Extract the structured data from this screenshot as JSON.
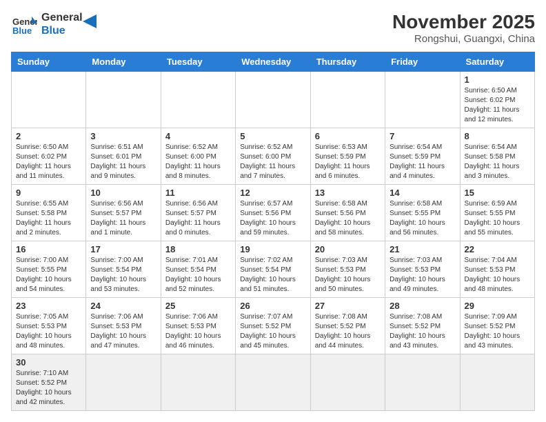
{
  "header": {
    "logo_general": "General",
    "logo_blue": "Blue",
    "month_title": "November 2025",
    "location": "Rongshui, Guangxi, China"
  },
  "weekdays": [
    "Sunday",
    "Monday",
    "Tuesday",
    "Wednesday",
    "Thursday",
    "Friday",
    "Saturday"
  ],
  "weeks": [
    [
      {
        "day": "",
        "info": ""
      },
      {
        "day": "",
        "info": ""
      },
      {
        "day": "",
        "info": ""
      },
      {
        "day": "",
        "info": ""
      },
      {
        "day": "",
        "info": ""
      },
      {
        "day": "",
        "info": ""
      },
      {
        "day": "1",
        "info": "Sunrise: 6:50 AM\nSunset: 6:02 PM\nDaylight: 11 hours and 12 minutes."
      }
    ],
    [
      {
        "day": "2",
        "info": "Sunrise: 6:50 AM\nSunset: 6:02 PM\nDaylight: 11 hours and 11 minutes."
      },
      {
        "day": "3",
        "info": "Sunrise: 6:51 AM\nSunset: 6:01 PM\nDaylight: 11 hours and 9 minutes."
      },
      {
        "day": "4",
        "info": "Sunrise: 6:52 AM\nSunset: 6:00 PM\nDaylight: 11 hours and 8 minutes."
      },
      {
        "day": "5",
        "info": "Sunrise: 6:52 AM\nSunset: 6:00 PM\nDaylight: 11 hours and 7 minutes."
      },
      {
        "day": "6",
        "info": "Sunrise: 6:53 AM\nSunset: 5:59 PM\nDaylight: 11 hours and 6 minutes."
      },
      {
        "day": "7",
        "info": "Sunrise: 6:54 AM\nSunset: 5:59 PM\nDaylight: 11 hours and 4 minutes."
      },
      {
        "day": "8",
        "info": "Sunrise: 6:54 AM\nSunset: 5:58 PM\nDaylight: 11 hours and 3 minutes."
      }
    ],
    [
      {
        "day": "9",
        "info": "Sunrise: 6:55 AM\nSunset: 5:58 PM\nDaylight: 11 hours and 2 minutes."
      },
      {
        "day": "10",
        "info": "Sunrise: 6:56 AM\nSunset: 5:57 PM\nDaylight: 11 hours and 1 minute."
      },
      {
        "day": "11",
        "info": "Sunrise: 6:56 AM\nSunset: 5:57 PM\nDaylight: 11 hours and 0 minutes."
      },
      {
        "day": "12",
        "info": "Sunrise: 6:57 AM\nSunset: 5:56 PM\nDaylight: 10 hours and 59 minutes."
      },
      {
        "day": "13",
        "info": "Sunrise: 6:58 AM\nSunset: 5:56 PM\nDaylight: 10 hours and 58 minutes."
      },
      {
        "day": "14",
        "info": "Sunrise: 6:58 AM\nSunset: 5:55 PM\nDaylight: 10 hours and 56 minutes."
      },
      {
        "day": "15",
        "info": "Sunrise: 6:59 AM\nSunset: 5:55 PM\nDaylight: 10 hours and 55 minutes."
      }
    ],
    [
      {
        "day": "16",
        "info": "Sunrise: 7:00 AM\nSunset: 5:55 PM\nDaylight: 10 hours and 54 minutes."
      },
      {
        "day": "17",
        "info": "Sunrise: 7:00 AM\nSunset: 5:54 PM\nDaylight: 10 hours and 53 minutes."
      },
      {
        "day": "18",
        "info": "Sunrise: 7:01 AM\nSunset: 5:54 PM\nDaylight: 10 hours and 52 minutes."
      },
      {
        "day": "19",
        "info": "Sunrise: 7:02 AM\nSunset: 5:54 PM\nDaylight: 10 hours and 51 minutes."
      },
      {
        "day": "20",
        "info": "Sunrise: 7:03 AM\nSunset: 5:53 PM\nDaylight: 10 hours and 50 minutes."
      },
      {
        "day": "21",
        "info": "Sunrise: 7:03 AM\nSunset: 5:53 PM\nDaylight: 10 hours and 49 minutes."
      },
      {
        "day": "22",
        "info": "Sunrise: 7:04 AM\nSunset: 5:53 PM\nDaylight: 10 hours and 48 minutes."
      }
    ],
    [
      {
        "day": "23",
        "info": "Sunrise: 7:05 AM\nSunset: 5:53 PM\nDaylight: 10 hours and 48 minutes."
      },
      {
        "day": "24",
        "info": "Sunrise: 7:06 AM\nSunset: 5:53 PM\nDaylight: 10 hours and 47 minutes."
      },
      {
        "day": "25",
        "info": "Sunrise: 7:06 AM\nSunset: 5:53 PM\nDaylight: 10 hours and 46 minutes."
      },
      {
        "day": "26",
        "info": "Sunrise: 7:07 AM\nSunset: 5:52 PM\nDaylight: 10 hours and 45 minutes."
      },
      {
        "day": "27",
        "info": "Sunrise: 7:08 AM\nSunset: 5:52 PM\nDaylight: 10 hours and 44 minutes."
      },
      {
        "day": "28",
        "info": "Sunrise: 7:08 AM\nSunset: 5:52 PM\nDaylight: 10 hours and 43 minutes."
      },
      {
        "day": "29",
        "info": "Sunrise: 7:09 AM\nSunset: 5:52 PM\nDaylight: 10 hours and 43 minutes."
      }
    ],
    [
      {
        "day": "30",
        "info": "Sunrise: 7:10 AM\nSunset: 5:52 PM\nDaylight: 10 hours and 42 minutes."
      },
      {
        "day": "",
        "info": ""
      },
      {
        "day": "",
        "info": ""
      },
      {
        "day": "",
        "info": ""
      },
      {
        "day": "",
        "info": ""
      },
      {
        "day": "",
        "info": ""
      },
      {
        "day": "",
        "info": ""
      }
    ]
  ]
}
